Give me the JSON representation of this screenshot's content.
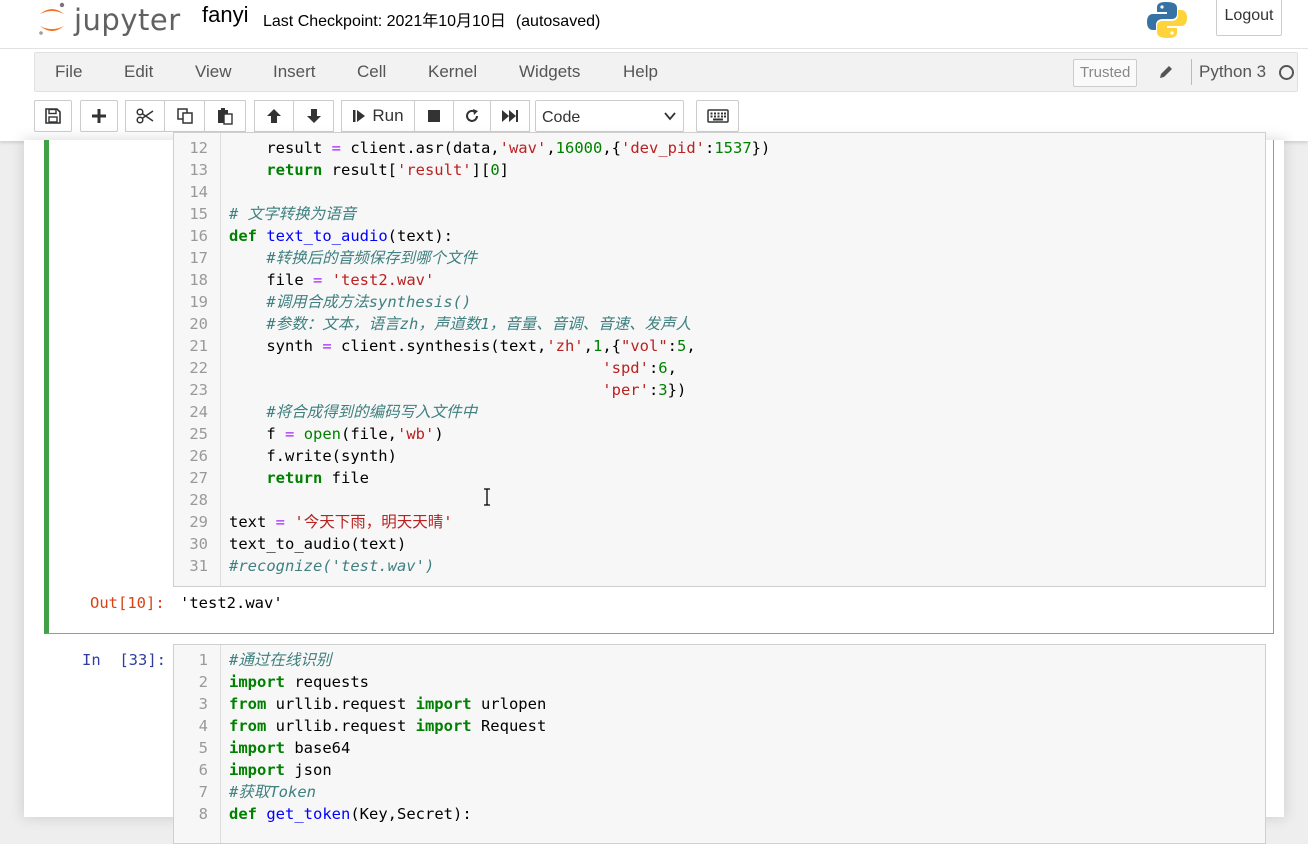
{
  "header": {
    "logo_text": "jupyter",
    "notebook_name": "fanyi",
    "checkpoint": "Last Checkpoint: 2021年10月10日",
    "autosave": "(autosaved)",
    "logout_label": "Logout"
  },
  "menubar": {
    "items": [
      "File",
      "Edit",
      "View",
      "Insert",
      "Cell",
      "Kernel",
      "Widgets",
      "Help"
    ],
    "trusted": "Trusted",
    "kernel_name": "Python 3"
  },
  "toolbar": {
    "run_label": "Run",
    "cell_type": "Code",
    "icons": [
      "save-icon",
      "plus-icon",
      "cut-icon",
      "copy-icon",
      "paste-icon",
      "arrow-up-icon",
      "arrow-down-icon",
      "run-icon",
      "stop-icon",
      "restart-icon",
      "fast-forward-icon",
      "keyboard-icon"
    ]
  },
  "cells": [
    {
      "output_prompt": "Out[10]:",
      "output_text": "'test2.wav'",
      "lines": [
        {
          "n": "12",
          "text": "    result = client.asr(data,'wav',16000,{'dev_pid':1537})"
        },
        {
          "n": "13",
          "text": "    return result['result'][0]"
        },
        {
          "n": "14",
          "text": ""
        },
        {
          "n": "15",
          "text": "# 文字转换为语音"
        },
        {
          "n": "16",
          "text": "def text_to_audio(text):"
        },
        {
          "n": "17",
          "text": "    #转换后的音频保存到哪个文件"
        },
        {
          "n": "18",
          "text": "    file = 'test2.wav'"
        },
        {
          "n": "19",
          "text": "    #调用合成方法synthesis()"
        },
        {
          "n": "20",
          "text": "    #参数：文本，语言zh，声道数1，音量、音调、音速、发声人"
        },
        {
          "n": "21",
          "text": "    synth = client.synthesis(text,'zh',1,{\"vol\":5,"
        },
        {
          "n": "22",
          "text": "                                        'spd':6,"
        },
        {
          "n": "23",
          "text": "                                        'per':3})"
        },
        {
          "n": "24",
          "text": "    #将合成得到的编码写入文件中"
        },
        {
          "n": "25",
          "text": "    f = open(file,'wb')"
        },
        {
          "n": "26",
          "text": "    f.write(synth)"
        },
        {
          "n": "27",
          "text": "    return file"
        },
        {
          "n": "28",
          "text": ""
        },
        {
          "n": "29",
          "text": "text = '今天下雨，明天天晴'"
        },
        {
          "n": "30",
          "text": "text_to_audio(text)"
        },
        {
          "n": "31",
          "text": "#recognize('test.wav')"
        }
      ]
    },
    {
      "input_prompt": "In  [33]:",
      "lines": [
        {
          "n": "1",
          "text": "#通过在线识别"
        },
        {
          "n": "2",
          "text": "import requests"
        },
        {
          "n": "3",
          "text": "from urllib.request import urlopen"
        },
        {
          "n": "4",
          "text": "from urllib.request import Request"
        },
        {
          "n": "5",
          "text": "import base64"
        },
        {
          "n": "6",
          "text": "import json"
        },
        {
          "n": "7",
          "text": "#获取Token"
        },
        {
          "n": "8",
          "text": "def get_token(Key,Secret):"
        }
      ]
    }
  ]
}
